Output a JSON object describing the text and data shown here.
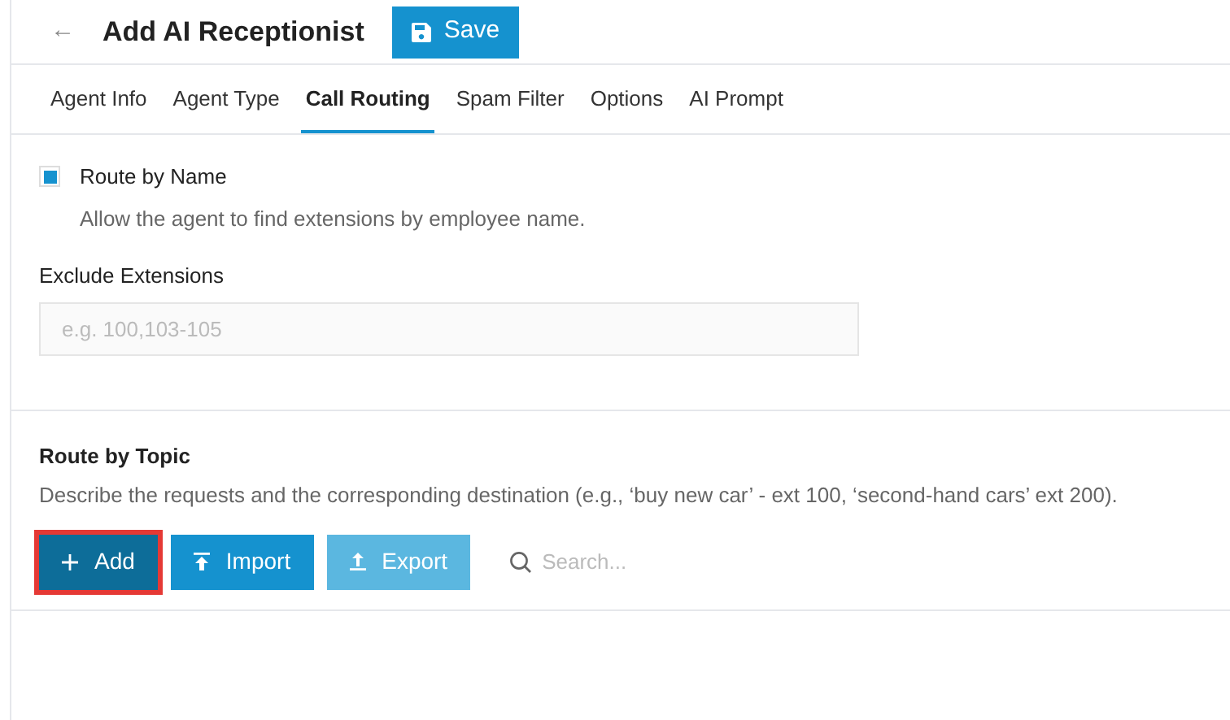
{
  "header": {
    "back": "←",
    "title": "Add AI Receptionist",
    "save": "Save"
  },
  "tabs": [
    {
      "label": "Agent Info",
      "selected": false
    },
    {
      "label": "Agent Type",
      "selected": false
    },
    {
      "label": "Call Routing",
      "selected": true
    },
    {
      "label": "Spam Filter",
      "selected": false
    },
    {
      "label": "Options",
      "selected": false
    },
    {
      "label": "AI Prompt",
      "selected": false
    }
  ],
  "route_by_name": {
    "label": "Route by Name",
    "checked": true,
    "hint": "Allow the agent to find extensions by employee name."
  },
  "exclude": {
    "label": "Exclude Extensions",
    "placeholder": "e.g. 100,103-105"
  },
  "route_by_topic": {
    "title": "Route by Topic",
    "description": "Describe the requests and the corresponding destination (e.g., ‘buy new car’ - ext 100, ‘second-hand cars’ ext 200).",
    "buttons": [
      {
        "kind": "add",
        "label": "Add",
        "highlighted": true,
        "disabled": false
      },
      {
        "kind": "import",
        "label": "Import",
        "highlighted": false,
        "disabled": false
      },
      {
        "kind": "export",
        "label": "Export",
        "highlighted": false,
        "disabled": true
      }
    ],
    "search": {
      "placeholder": "Search..."
    }
  }
}
